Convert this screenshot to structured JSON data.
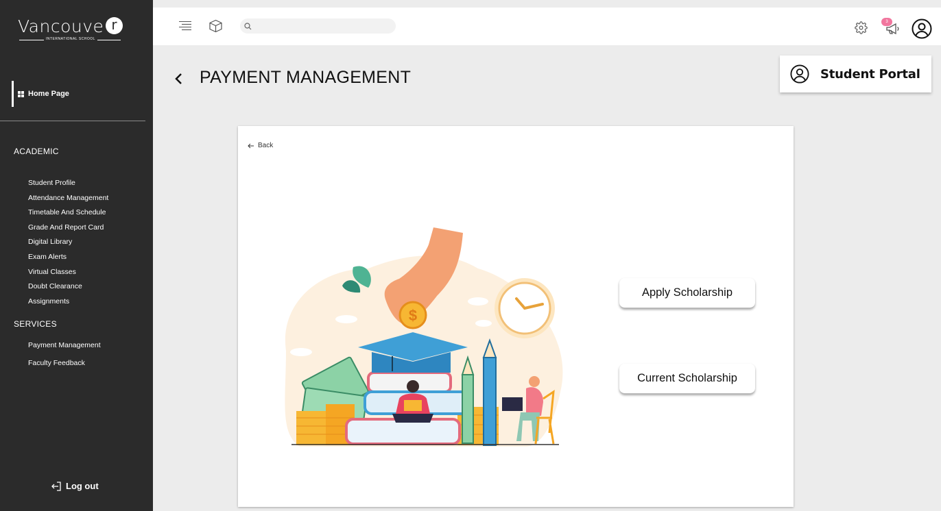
{
  "brand": {
    "name": "Vancouve",
    "mark": "r",
    "subtitle": "INTERNATIONAL SCHOOL"
  },
  "sidebar": {
    "home_label": "Home Page",
    "academic_title": "ACADEMIC",
    "academic_items": [
      "Student Profile",
      "Attendance Management",
      "Timetable And Schedule",
      "Grade And Report Card",
      "Digital Library",
      "Exam Alerts",
      "Virtual Classes",
      "Doubt Clearance",
      "Assignments"
    ],
    "services_title": "SERVICES",
    "services_items": [
      "Payment Management",
      "Faculty Feedback"
    ],
    "logout_label": "Log out"
  },
  "topbar": {
    "search_placeholder": "",
    "notification_count": "3"
  },
  "page": {
    "title": "PAYMENT MANAGEMENT",
    "portal_label": "Student Portal"
  },
  "panel": {
    "back_label": "Back",
    "apply_button": "Apply Scholarship",
    "current_button": "Current Scholarship"
  },
  "colors": {
    "sidebar_bg": "#2b2b2b",
    "page_bg": "#ececec",
    "badge": "#f1769e",
    "accent_blue": "#3f9fd6",
    "coin": "#f7b733"
  }
}
